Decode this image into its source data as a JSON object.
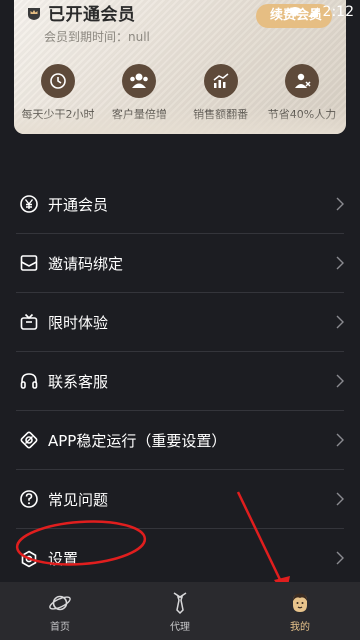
{
  "status_bar": {
    "time": "2:12"
  },
  "member_card": {
    "title": "已开通会员",
    "expire_text": "会员到期时间：null",
    "renew_button": "续费会员",
    "benefits": [
      {
        "label": "每天少干2小时",
        "icon": "clock-icon"
      },
      {
        "label": "客户量倍增",
        "icon": "users-icon"
      },
      {
        "label": "销售额翻番",
        "icon": "growth-chart-icon"
      },
      {
        "label": "节省40%人力",
        "icon": "save-labor-icon"
      }
    ]
  },
  "menu": {
    "items": [
      {
        "label": "开通会员",
        "icon": "yen-icon"
      },
      {
        "label": "邀请码绑定",
        "icon": "envelope-icon"
      },
      {
        "label": "限时体验",
        "icon": "tv-icon"
      },
      {
        "label": "联系客服",
        "icon": "headset-icon"
      },
      {
        "label": "APP稳定运行（重要设置）",
        "icon": "shield-icon"
      },
      {
        "label": "常见问题",
        "icon": "question-icon"
      },
      {
        "label": "设置",
        "icon": "settings-icon"
      }
    ]
  },
  "bottom_nav": {
    "items": [
      {
        "label": "首页",
        "icon": "planet-icon"
      },
      {
        "label": "代理",
        "icon": "tie-icon"
      },
      {
        "label": "我的",
        "icon": "profile-icon"
      }
    ],
    "active_index": 2
  },
  "colors": {
    "background": "#1c1d22",
    "accent_gold": "#e6be83",
    "annotation_red": "#e01e1e",
    "nav_background": "#2a2a2e"
  }
}
